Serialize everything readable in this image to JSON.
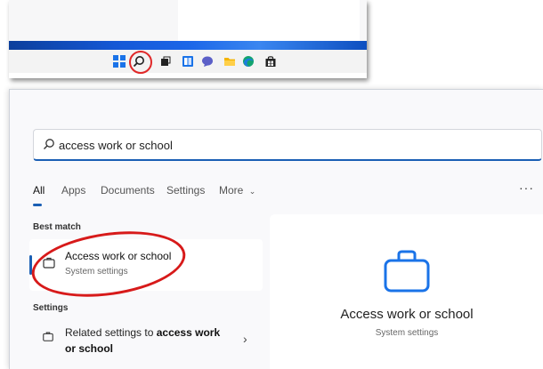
{
  "taskbar": {
    "icons": [
      "windows-start-icon",
      "search-icon",
      "task-view-icon",
      "widgets-icon",
      "chat-icon",
      "file-explorer-icon",
      "edge-icon",
      "store-icon"
    ]
  },
  "search": {
    "query": "access work or school"
  },
  "tabs": [
    {
      "label": "All",
      "active": true
    },
    {
      "label": "Apps"
    },
    {
      "label": "Documents"
    },
    {
      "label": "Settings"
    },
    {
      "label": "More"
    }
  ],
  "more_options": "···",
  "best_match": {
    "section_label": "Best match",
    "title": "Access work or school",
    "subtitle": "System settings"
  },
  "settings_section": {
    "section_label": "Settings",
    "item_prefix": "Related settings to ",
    "item_bold": "access work or school"
  },
  "preview": {
    "title": "Access work or school",
    "subtitle": "System settings"
  },
  "colors": {
    "accent": "#1a5fb4",
    "highlight_red": "#d71a1a",
    "icon_blue": "#1a73e8"
  }
}
